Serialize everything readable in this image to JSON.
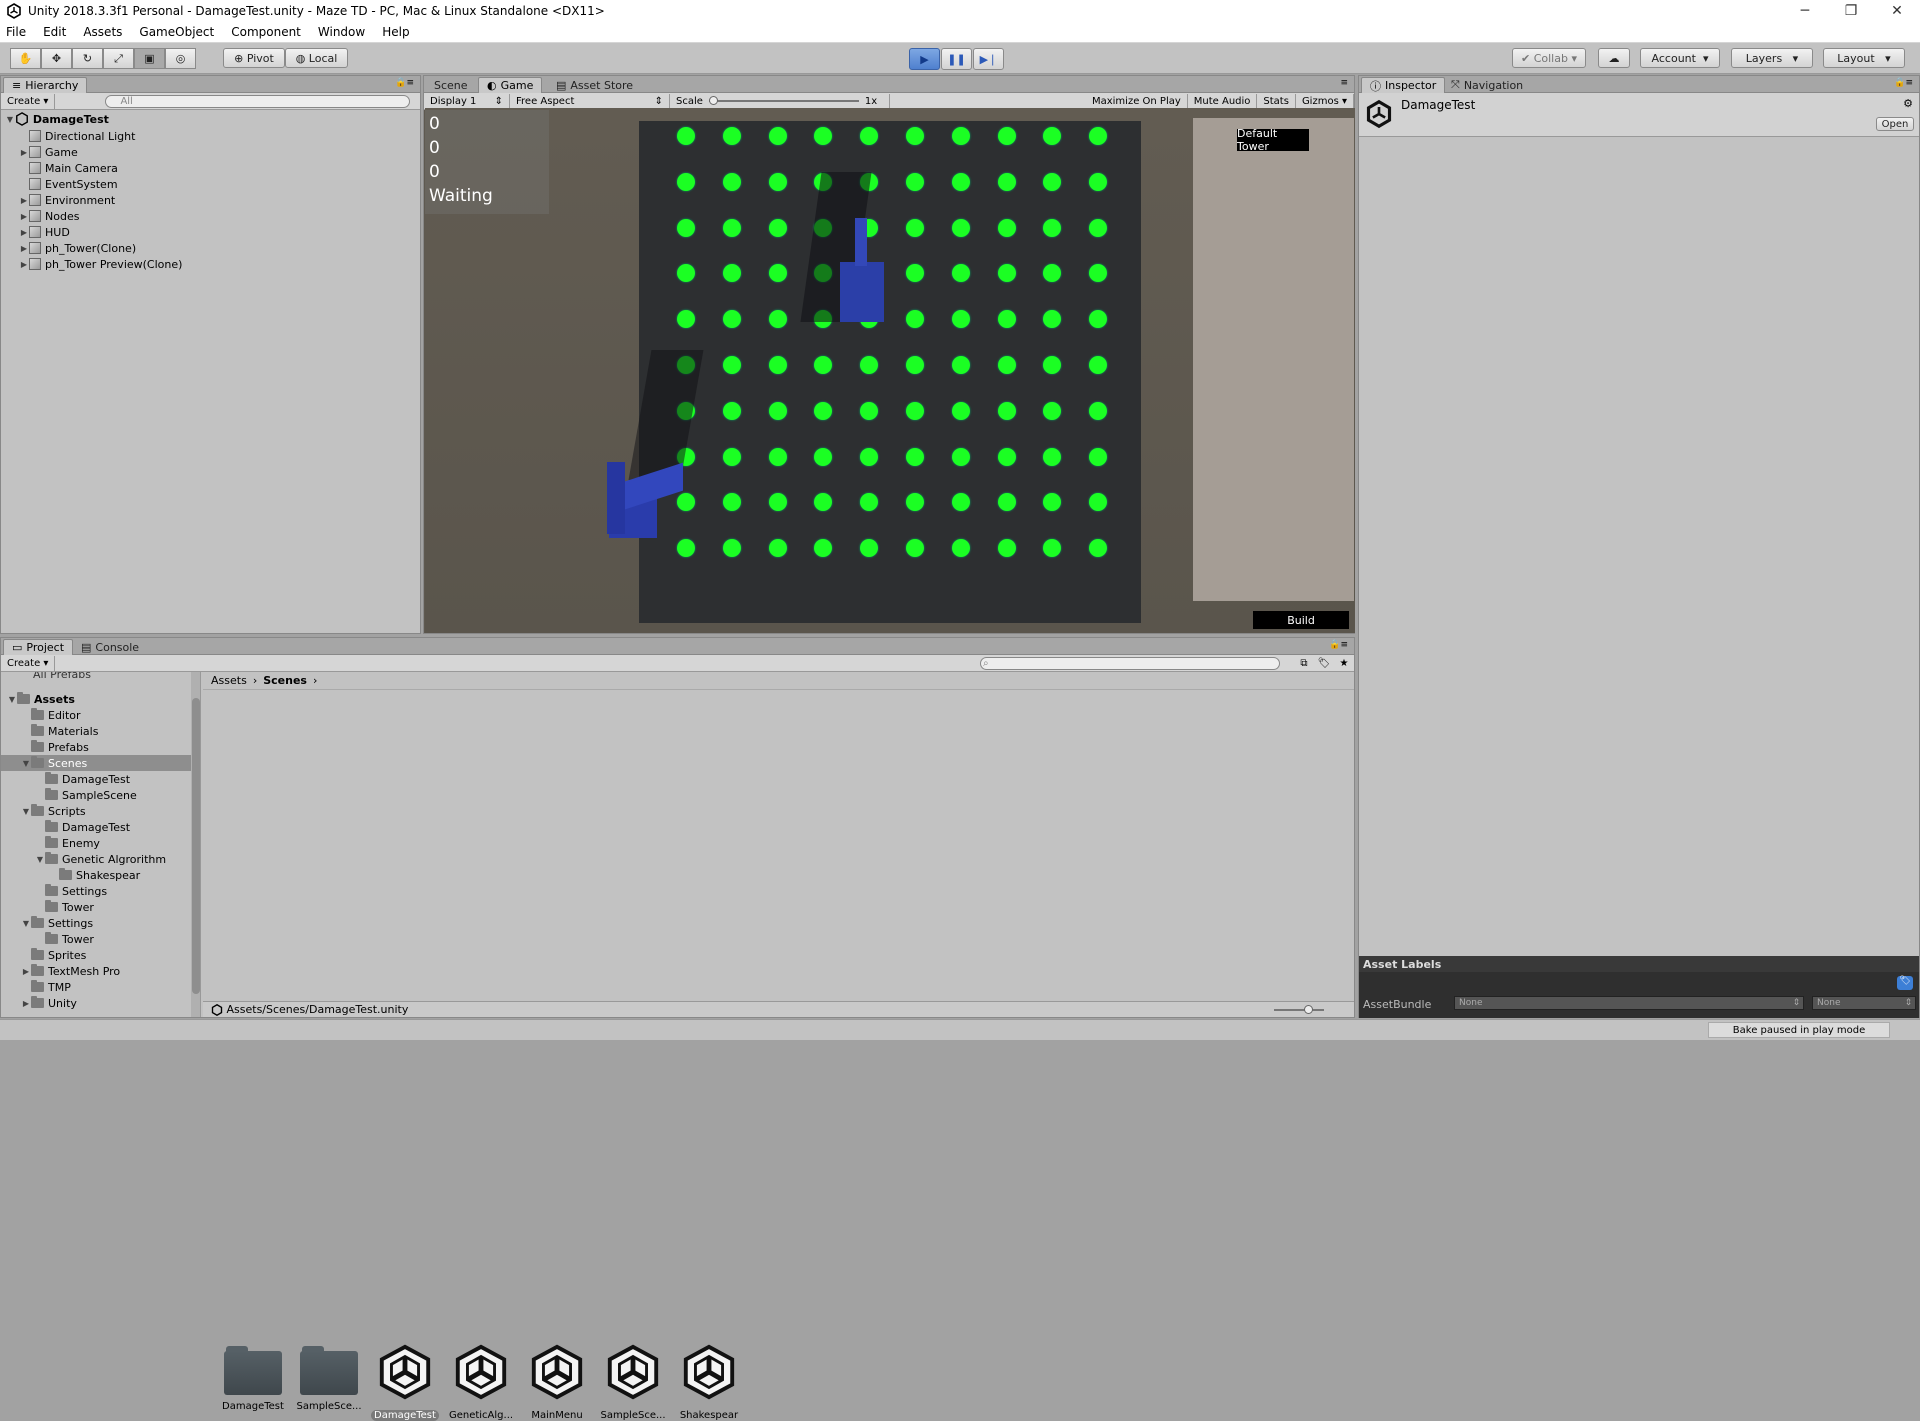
{
  "window": {
    "title": "Unity 2018.3.3f1 Personal - DamageTest.unity - Maze TD - PC, Mac & Linux Standalone <DX11>",
    "minimize": "─",
    "maximize": "❐",
    "close": "✕"
  },
  "menu": [
    "File",
    "Edit",
    "Assets",
    "GameObject",
    "Component",
    "Window",
    "Help"
  ],
  "toolbar": {
    "tools": [
      "hand-icon",
      "move-icon",
      "rotate-icon",
      "scale-icon",
      "rect-icon",
      "transform-icon"
    ],
    "pivot": "Pivot",
    "local": "Local",
    "collab": "Collab",
    "account": "Account",
    "layers": "Layers",
    "layout": "Layout"
  },
  "hierarchy": {
    "tab": "Hierarchy",
    "create": "Create",
    "search_placeholder": "All",
    "scene": "DamageTest",
    "items": [
      {
        "label": "Directional Light",
        "expandable": false
      },
      {
        "label": "Game",
        "expandable": true
      },
      {
        "label": "Main Camera",
        "expandable": false
      },
      {
        "label": "EventSystem",
        "expandable": false
      },
      {
        "label": "Environment",
        "expandable": true
      },
      {
        "label": "Nodes",
        "expandable": true
      },
      {
        "label": "HUD",
        "expandable": true
      },
      {
        "label": "ph_Tower(Clone)",
        "expandable": true
      },
      {
        "label": "ph_Tower Preview(Clone)",
        "expandable": true
      }
    ]
  },
  "game_view": {
    "tabs": [
      "Scene",
      "Game",
      "Asset Store"
    ],
    "display": "Display 1",
    "aspect": "Free Aspect",
    "scale_label": "Scale",
    "scale_value": "1x",
    "maximize_on_play": "Maximize On Play",
    "mute_audio": "Mute Audio",
    "stats": "Stats",
    "gizmos": "Gizmos",
    "hud": [
      "0",
      "0",
      "0",
      "Waiting"
    ],
    "default_tower_button": "Default Tower",
    "build_button": "Build",
    "grid": {
      "rows": 10,
      "cols": 10,
      "color": "#1bff23"
    }
  },
  "inspector": {
    "tabs": [
      "Inspector",
      "Navigation"
    ],
    "asset_name": "DamageTest",
    "open_button": "Open",
    "asset_labels": "Asset Labels",
    "asset_bundle_label": "AssetBundle",
    "asset_bundle_value": "None",
    "asset_bundle_variant": "None"
  },
  "project": {
    "tabs": [
      "Project",
      "Console"
    ],
    "create": "Create",
    "top_cut_item": "All Prefabs",
    "tree": [
      {
        "label": "Assets",
        "depth": 0,
        "bold": true,
        "expanded": true
      },
      {
        "label": "Editor",
        "depth": 1
      },
      {
        "label": "Materials",
        "depth": 1
      },
      {
        "label": "Prefabs",
        "depth": 1
      },
      {
        "label": "Scenes",
        "depth": 1,
        "expanded": true,
        "selected": true
      },
      {
        "label": "DamageTest",
        "depth": 2
      },
      {
        "label": "SampleScene",
        "depth": 2
      },
      {
        "label": "Scripts",
        "depth": 1,
        "expanded": true
      },
      {
        "label": "DamageTest",
        "depth": 2
      },
      {
        "label": "Enemy",
        "depth": 2
      },
      {
        "label": "Genetic Algrorithm",
        "depth": 2,
        "expanded": true
      },
      {
        "label": "Shakespear",
        "depth": 3
      },
      {
        "label": "Settings",
        "depth": 2
      },
      {
        "label": "Tower",
        "depth": 2
      },
      {
        "label": "Settings",
        "depth": 1,
        "expanded": true
      },
      {
        "label": "Tower",
        "depth": 2
      },
      {
        "label": "Sprites",
        "depth": 1
      },
      {
        "label": "TextMesh Pro",
        "depth": 1,
        "collapsed": true
      },
      {
        "label": "TMP",
        "depth": 1
      },
      {
        "label": "Unity",
        "depth": 1,
        "collapsed": true
      }
    ],
    "breadcrumb": [
      "Assets",
      "Scenes"
    ],
    "assets": [
      {
        "label": "DamageTest",
        "kind": "folder"
      },
      {
        "label": "SampleSce...",
        "kind": "folder"
      },
      {
        "label": "DamageTest",
        "kind": "scene",
        "selected": true
      },
      {
        "label": "GeneticAlg...",
        "kind": "scene"
      },
      {
        "label": "MainMenu",
        "kind": "scene"
      },
      {
        "label": "SampleSce...",
        "kind": "scene"
      },
      {
        "label": "Shakespear",
        "kind": "scene"
      }
    ],
    "path": "Assets/Scenes/DamageTest.unity"
  },
  "status": {
    "bake": "Bake paused in play mode"
  }
}
